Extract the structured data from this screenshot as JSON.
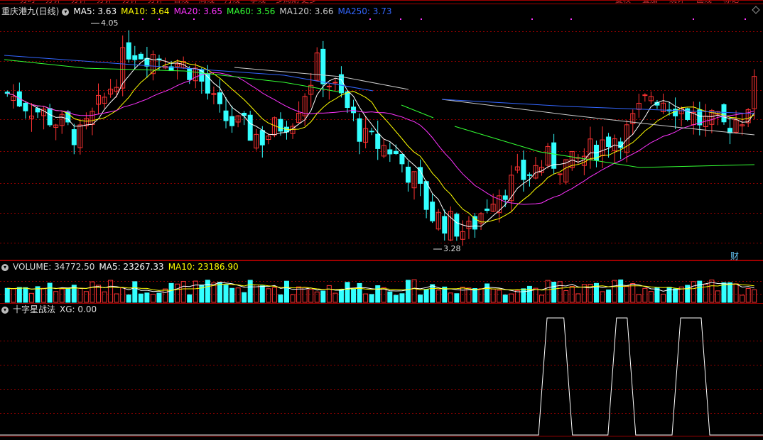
{
  "top_tabs": [
    "分时",
    "分钟",
    "分钟",
    "分钟",
    "分钟",
    "分钟",
    "日线",
    "周线",
    "月线",
    "季线",
    "多周期",
    "更多"
  ],
  "toolbar_right": [
    "复权",
    "叠加",
    "统计",
    "画线",
    "标记"
  ],
  "price_panel": {
    "stock_title": "重庆港九(日线)",
    "ma_labels": [
      {
        "label": "MA5: 3.63",
        "color": "#ffffff"
      },
      {
        "label": "MA10: 3.64",
        "color": "#ffff00"
      },
      {
        "label": "MA20: 3.65",
        "color": "#ff33ff"
      },
      {
        "label": "MA60: 3.56",
        "color": "#33ff33"
      },
      {
        "label": "MA120: 3.66",
        "color": "#cccccc"
      },
      {
        "label": "MA250: 3.73",
        "color": "#3366ff"
      }
    ],
    "high_marker": "4.05",
    "low_marker": "3.28",
    "cai_badge": "财"
  },
  "volume_panel": {
    "labels": [
      {
        "label": "VOLUME: 34772.50",
        "color": "#dddddd"
      },
      {
        "label": "MA5: 23267.33",
        "color": "#ffffff"
      },
      {
        "label": "MA10: 23186.90",
        "color": "#ffff00"
      }
    ]
  },
  "indicator_panel": {
    "labels": [
      {
        "label": "十字星战法",
        "color": "#dddddd"
      },
      {
        "label": "XG: 0.00",
        "color": "#dddddd"
      }
    ],
    "signals": [
      {
        "start": 0.717,
        "end": 0.739
      },
      {
        "start": 0.808,
        "end": 0.822
      },
      {
        "start": 0.892,
        "end": 0.919
      }
    ]
  },
  "colors": {
    "up": "#ff3333",
    "down": "#33ffff",
    "grid": "#8b0000",
    "border": "#a00000"
  },
  "chart_data": {
    "type": "candlestick",
    "price_range": [
      3.28,
      4.05
    ],
    "ma_periods": [
      5,
      10,
      20,
      60,
      120,
      250
    ]
  }
}
